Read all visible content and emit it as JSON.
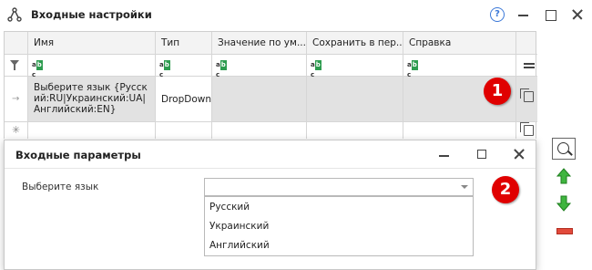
{
  "window": {
    "title": "Входные настройки",
    "icons": {
      "app": "share-nodes-icon",
      "help": "help-icon",
      "help_glyph": "?"
    }
  },
  "grid": {
    "columns": [
      "Имя",
      "Тип",
      "Значение по ум...",
      "Сохранить в пер...",
      "Справка"
    ],
    "filter_glyph": "abc",
    "rows": [
      {
        "name": "Выберите язык {Русский:RU|Украинский:UA|Английский:EN}",
        "type": "DropDown",
        "default": "",
        "save_to": "",
        "help": ""
      }
    ]
  },
  "badges": {
    "first": "1",
    "second": "2",
    "color": "#e00000"
  },
  "dialog": {
    "title": "Входные параметры",
    "field_label": "Выберите язык",
    "selected_value": "",
    "options": [
      "Русский",
      "Украинский",
      "Английский"
    ]
  },
  "toolbar": {
    "icons": [
      "search-icon",
      "move-up-icon",
      "move-down-icon",
      "remove-icon"
    ],
    "colors": {
      "up": "#3fb53f",
      "down": "#3fb53f",
      "remove": "#e24a3b"
    }
  }
}
